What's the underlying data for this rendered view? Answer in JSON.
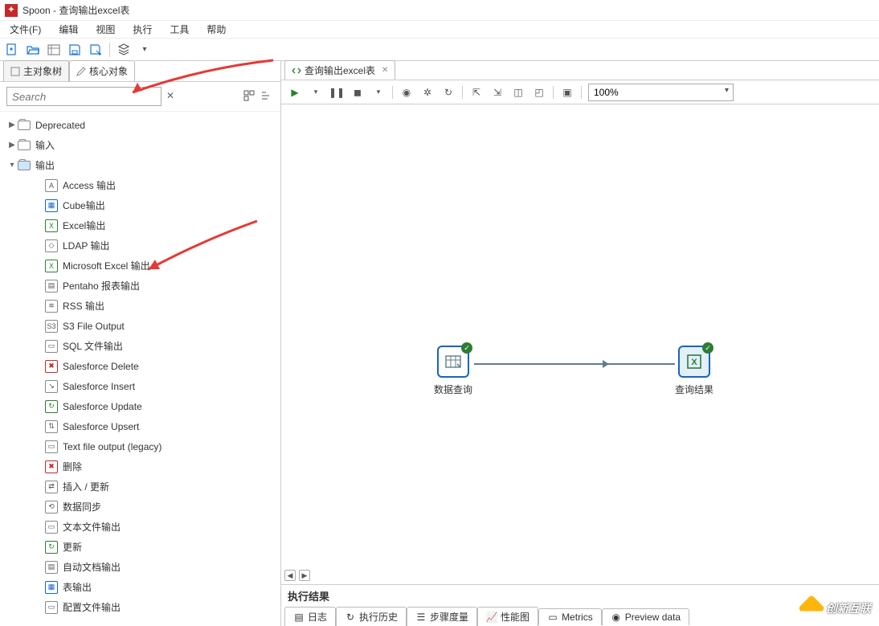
{
  "window": {
    "title": "Spoon - 查询输出excel表"
  },
  "menu": {
    "file": "文件(F)",
    "edit": "编辑",
    "view": "视图",
    "run": "执行",
    "tools": "工具",
    "help": "帮助"
  },
  "side_tabs": {
    "main_tree": "主对象树",
    "design": "核心对象"
  },
  "search": {
    "placeholder": "Search"
  },
  "tree": {
    "deprecated": "Deprecated",
    "input": "输入",
    "output": "输出",
    "items": [
      "Access 输出",
      "Cube输出",
      "Excel输出",
      "LDAP 输出",
      "Microsoft Excel 输出",
      "Pentaho 报表输出",
      "RSS 输出",
      "S3 File Output",
      "SQL 文件输出",
      "Salesforce Delete",
      "Salesforce Insert",
      "Salesforce Update",
      "Salesforce Upsert",
      "Text file output (legacy)",
      "删除",
      "插入 / 更新",
      "数据同步",
      "文本文件输出",
      "更新",
      "自动文档输出",
      "表输出",
      "配置文件输出"
    ]
  },
  "canvas_tab": {
    "label": "查询输出excel表"
  },
  "zoom": {
    "value": "100%"
  },
  "steps": {
    "query": "数据查询",
    "result": "查询结果"
  },
  "results": {
    "title": "执行结果",
    "tabs": {
      "log": "日志",
      "history": "执行历史",
      "step_metrics": "步骤度量",
      "perf": "性能图",
      "metrics": "Metrics",
      "preview": "Preview data"
    }
  },
  "brand": {
    "text": "创新互联"
  }
}
